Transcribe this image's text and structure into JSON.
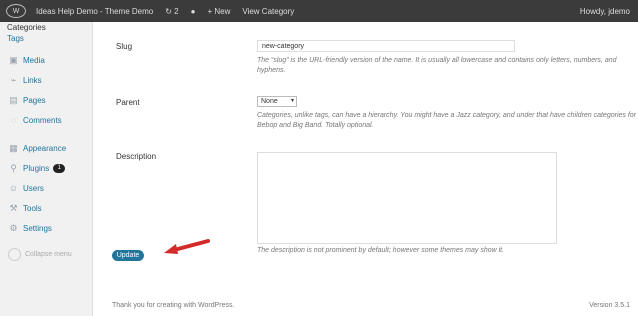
{
  "adminbar": {
    "site_title": "Ideas Help Demo - Theme Demo",
    "updates_count": "2",
    "new_label": "New",
    "view_link": "View Category",
    "user": "Howdy, jdemo"
  },
  "sidebar": {
    "submenu": [
      "Categories",
      "Tags"
    ],
    "menu": [
      {
        "label": "Media",
        "icon": "media-icon"
      },
      {
        "label": "Links",
        "icon": "links-icon"
      },
      {
        "label": "Pages",
        "icon": "pages-icon"
      },
      {
        "label": "Comments",
        "icon": "comments-icon"
      },
      {
        "label": "Appearance",
        "icon": "appearance-icon"
      },
      {
        "label": "Plugins",
        "icon": "plugins-icon",
        "badge": "1"
      },
      {
        "label": "Users",
        "icon": "users-icon"
      },
      {
        "label": "Tools",
        "icon": "tools-icon"
      },
      {
        "label": "Settings",
        "icon": "settings-icon"
      }
    ],
    "collapse": "Collapse menu"
  },
  "form": {
    "slug_label": "Slug",
    "slug_value": "new-category",
    "slug_desc": "The “slug” is the URL-friendly version of the name. It is usually all lowercase and contains only letters, numbers, and hyphens.",
    "parent_label": "Parent",
    "parent_value": "None",
    "parent_desc": "Categories, unlike tags, can have a hierarchy. You might have a Jazz category, and under that have children categories for Bebop and Big Band. Totally optional.",
    "description_label": "Description",
    "description_desc": "The description is not prominent by default; however some themes may show it.",
    "update_button": "Update"
  },
  "footer": {
    "thanks": "Thank you for creating with WordPress.",
    "version": "Version 3.5.1"
  },
  "colors": {
    "accent": "#21759b",
    "arrow": "#d32a2a"
  }
}
